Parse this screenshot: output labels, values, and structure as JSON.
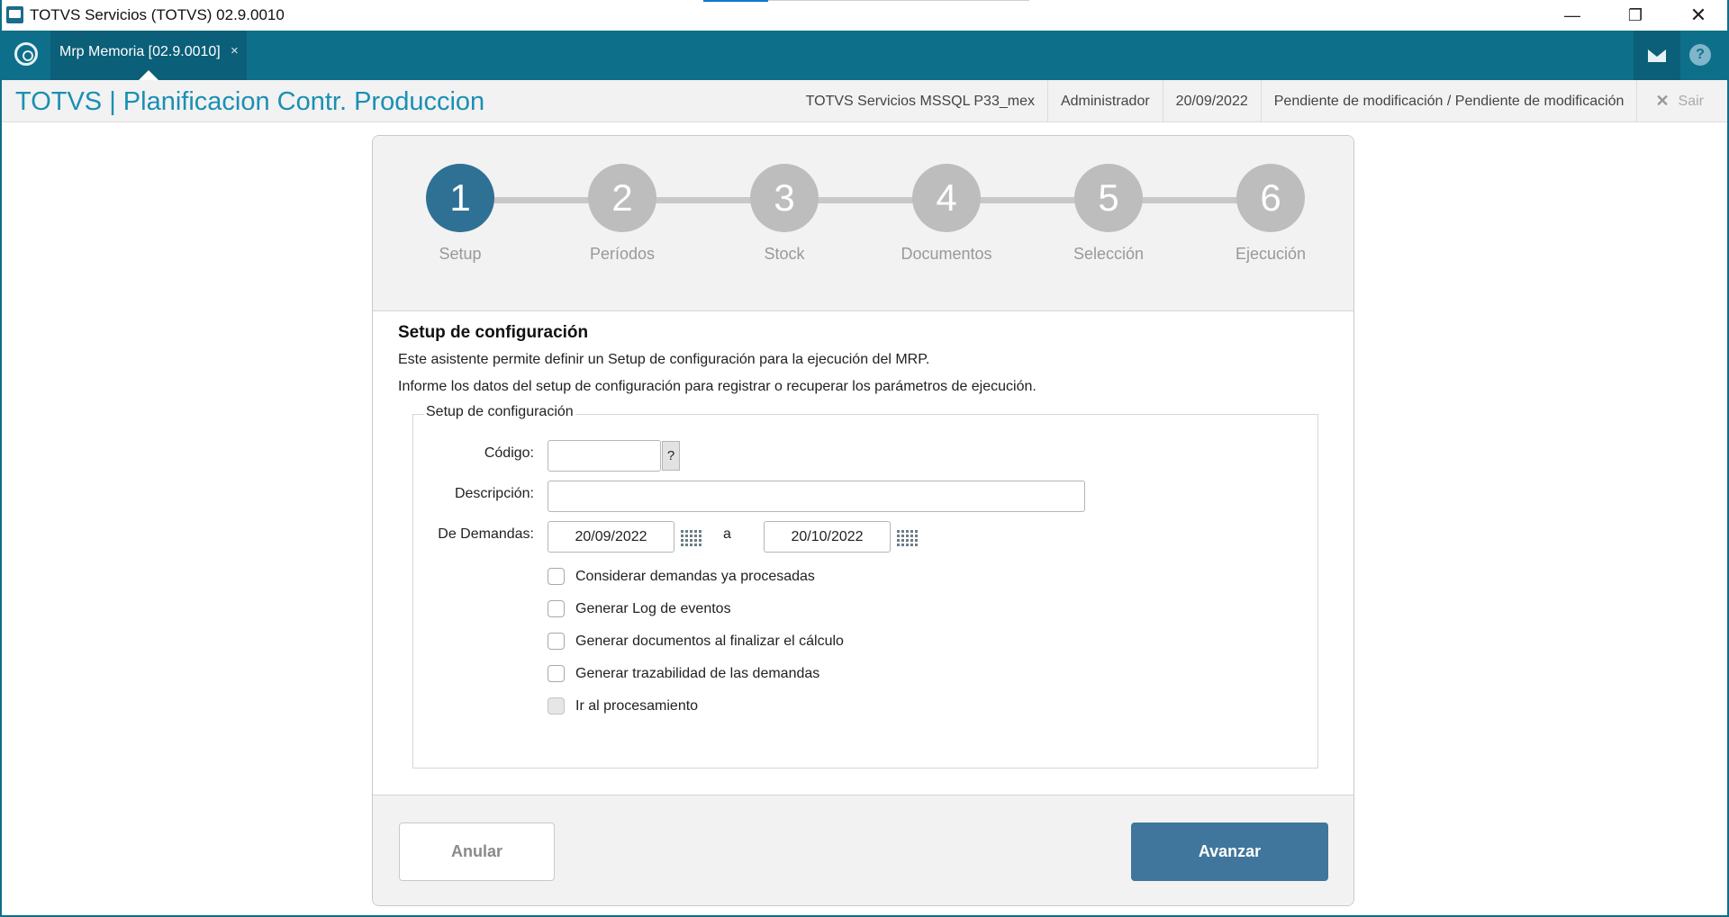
{
  "window": {
    "title": "TOTVS Servicios (TOTVS) 02.9.0010",
    "minimize": "—",
    "restore": "❐",
    "close": "✕"
  },
  "tabbar": {
    "active_tab": "Mrp Memoria [02.9.0010]",
    "tab_close": "×",
    "help": "?"
  },
  "header": {
    "title": "TOTVS | Planificacion Contr. Produccion",
    "environment": "TOTVS Servicios MSSQL P33_mex",
    "user": "Administrador",
    "date": "20/09/2022",
    "status": "Pendiente de modificación / Pendiente de modificación",
    "exit_icon": "✕",
    "exit_label": "Sair"
  },
  "steps": [
    {
      "number": "1",
      "label": "Setup",
      "active": true
    },
    {
      "number": "2",
      "label": "Períodos",
      "active": false
    },
    {
      "number": "3",
      "label": "Stock",
      "active": false
    },
    {
      "number": "4",
      "label": "Documentos",
      "active": false
    },
    {
      "number": "5",
      "label": "Selección",
      "active": false
    },
    {
      "number": "6",
      "label": "Ejecución",
      "active": false
    }
  ],
  "content": {
    "heading": "Setup de configuración",
    "description1": "Este asistente permite definir un Setup de configuración para la ejecución del MRP.",
    "description2": "Informe los datos del setup de configuración para registrar o recuperar los parámetros de ejecución."
  },
  "form": {
    "legend": "Setup de configuración",
    "codigo_label": "Código:",
    "codigo_value": "",
    "codigo_lookup": "?",
    "descripcion_label": "Descripción:",
    "descripcion_value": "",
    "demandas_label": "De Demandas:",
    "date_from": "20/09/2022",
    "date_separator": "a",
    "date_to": "20/10/2022",
    "checkboxes": [
      {
        "label": "Considerar demandas ya procesadas",
        "checked": false,
        "disabled": false
      },
      {
        "label": "Generar Log de eventos",
        "checked": false,
        "disabled": false
      },
      {
        "label": "Generar documentos al finalizar el cálculo",
        "checked": false,
        "disabled": false
      },
      {
        "label": "Generar trazabilidad de las demandas",
        "checked": false,
        "disabled": false
      },
      {
        "label": "Ir al procesamiento",
        "checked": false,
        "disabled": true
      }
    ]
  },
  "buttons": {
    "cancel": "Anular",
    "next": "Avanzar"
  },
  "colors": {
    "brand": "#0e6f8a",
    "title_text": "#1a8fb4",
    "step_active": "#2f7195",
    "step_inactive": "#bdbdbd",
    "primary_button": "#40769b"
  }
}
